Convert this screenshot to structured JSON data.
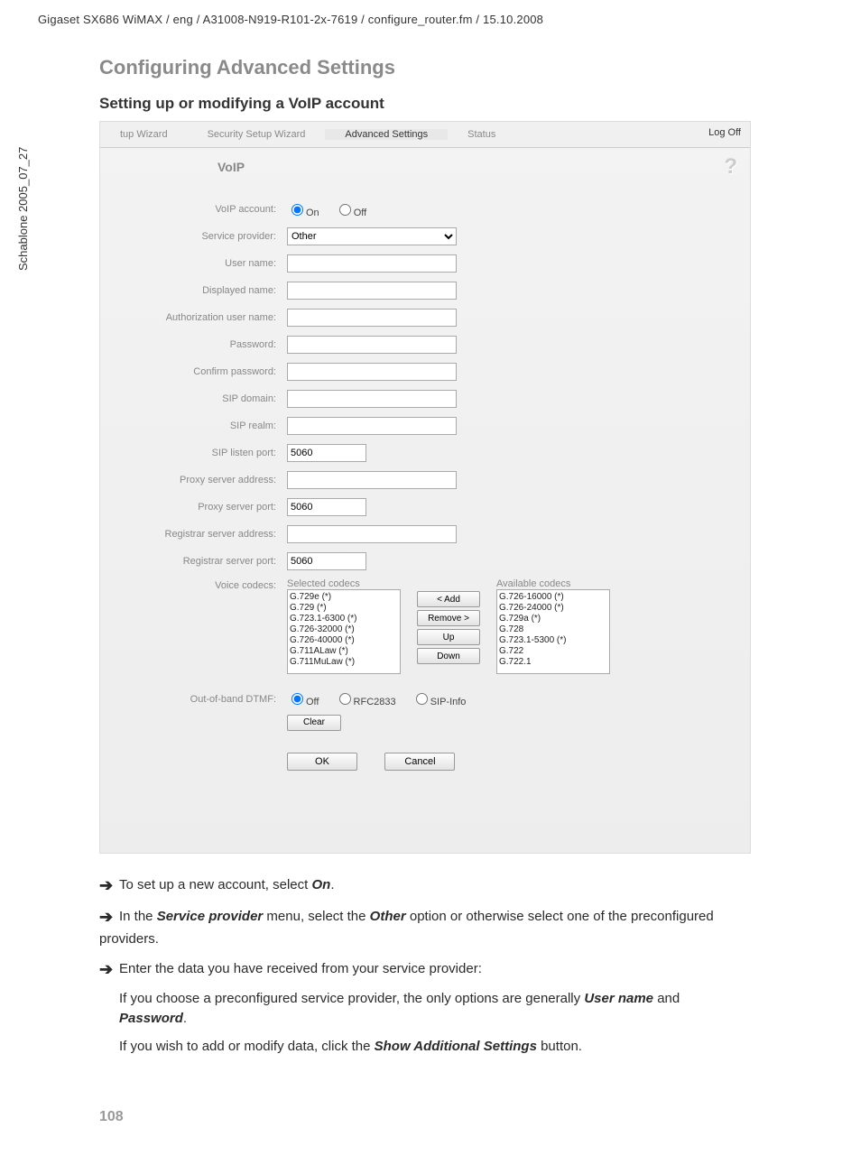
{
  "meta": {
    "header_path": "Gigaset SX686 WiMAX / eng / A31008-N919-R101-2x-7619 / configure_router.fm / 15.10.2008",
    "side_label": "Schablone 2005_07_27",
    "page_number": "108"
  },
  "titles": {
    "main": "Configuring Advanced Settings",
    "sub": "Setting up or modifying a VoIP account"
  },
  "tabs": {
    "t1": "tup Wizard",
    "t2": "Security Setup Wizard",
    "t3": "Advanced Settings",
    "t4": "Status",
    "logoff": "Log Off"
  },
  "panel": {
    "voip_heading": "VoIP",
    "help": "?"
  },
  "form": {
    "voip_account_label": "VoIP account:",
    "radio_on": "On",
    "radio_off": "Off",
    "service_provider_label": "Service provider:",
    "service_provider_value": "Other",
    "user_name_label": "User name:",
    "displayed_name_label": "Displayed name:",
    "auth_user_label": "Authorization user name:",
    "password_label": "Password:",
    "confirm_password_label": "Confirm password:",
    "sip_domain_label": "SIP domain:",
    "sip_realm_label": "SIP realm:",
    "sip_listen_port_label": "SIP listen port:",
    "sip_listen_port_value": "5060",
    "proxy_addr_label": "Proxy server address:",
    "proxy_port_label": "Proxy server port:",
    "proxy_port_value": "5060",
    "reg_addr_label": "Registrar server address:",
    "reg_port_label": "Registrar server port:",
    "reg_port_value": "5060",
    "voice_codecs_label": "Voice codecs:",
    "selected_header": "Selected codecs",
    "available_header": "Available codecs",
    "selected_list": [
      "G.729e (*)",
      "G.729 (*)",
      "G.723.1-6300 (*)",
      "G.726-32000 (*)",
      "G.726-40000 (*)",
      "G.711ALaw (*)",
      "G.711MuLaw (*)"
    ],
    "available_list": [
      "G.726-16000 (*)",
      "G.726-24000 (*)",
      "G.729a (*)",
      "G.728",
      "G.723.1-5300 (*)",
      "G.722",
      "G.722.1"
    ],
    "btn_add": "< Add",
    "btn_remove": "Remove >",
    "btn_up": "Up",
    "btn_down": "Down",
    "dtmf_label": "Out-of-band DTMF:",
    "dtmf_off": "Off",
    "dtmf_rfc": "RFC2833",
    "dtmf_sip": "SIP-Info",
    "btn_clear": "Clear",
    "btn_ok": "OK",
    "btn_cancel": "Cancel"
  },
  "instructions": {
    "l1a": "To set up a new account, select ",
    "l1b": "On",
    "l1c": ".",
    "l2a": "In the ",
    "l2b": "Service provider",
    "l2c": " menu, select the ",
    "l2d": "Other",
    "l2e": " option or otherwise select one of the preconfigured providers.",
    "l3": "Enter the data you have received from your service provider:",
    "l4a": "If you choose a preconfigured service provider, the only options are generally ",
    "l4b": "User name",
    "l4c": " and ",
    "l4d": "Password",
    "l4e": ".",
    "l5a": "If you wish to add or modify data, click the ",
    "l5b": "Show Additional Settings",
    "l5c": " button."
  }
}
